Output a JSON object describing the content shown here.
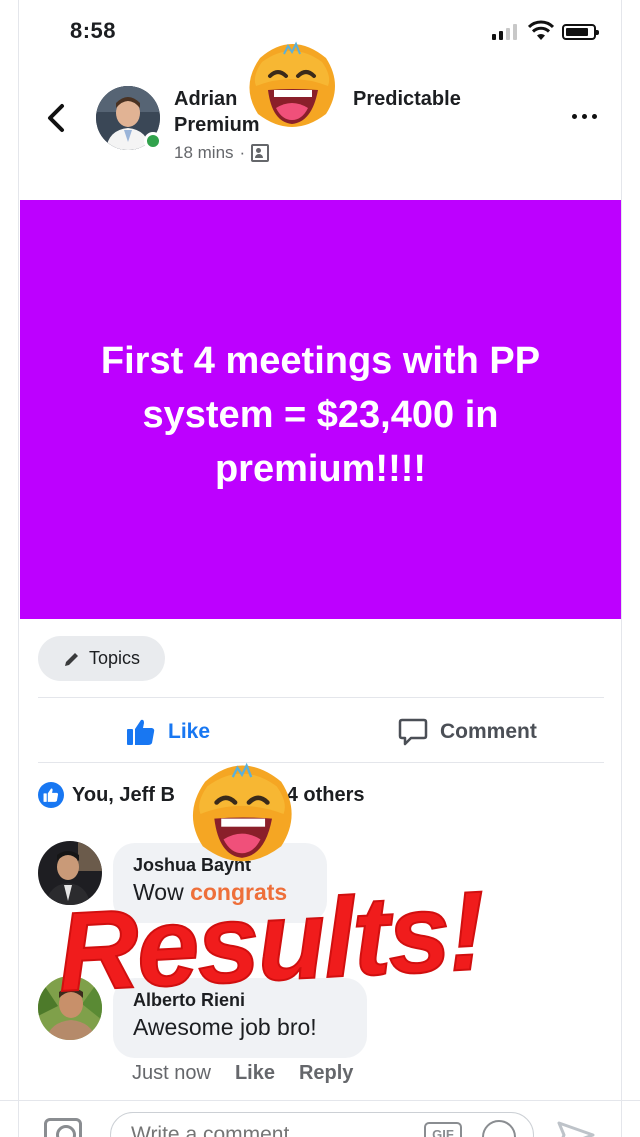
{
  "status_bar": {
    "time": "8:58"
  },
  "post": {
    "author_first": "Adrian",
    "group_name": "Predictable",
    "group_name_line2": "Premium",
    "time_ago": "18 mins",
    "separator": "·",
    "banner_text": "First 4 meetings with PP system = $23,400 in premium!!!!",
    "banner_color": "#bd00ff"
  },
  "topics": {
    "label": "Topics"
  },
  "actions": {
    "like": "Like",
    "comment": "Comment",
    "like_color": "#1877f2"
  },
  "reactions": {
    "summary_start": "You, Jeff B",
    "summary_end": "d 4 others"
  },
  "comments": [
    {
      "author": "Joshua Baynt",
      "text_plain": "Wow ",
      "text_highlight": "congrats",
      "highlight_color": "#ee6f3a"
    },
    {
      "author": "Alberto Rieni",
      "text": "Awesome job  bro!",
      "time": "Just now",
      "like": "Like",
      "reply": "Reply"
    }
  ],
  "composer": {
    "placeholder": "Write a comment...",
    "gif": "GIF"
  },
  "overlay": {
    "text": "Results!",
    "color": "#f01c1c"
  },
  "icons": {
    "back": "chevron-left-icon",
    "more": "more-dots-icon",
    "audience": "group-audience-icon",
    "pencil": "pencil-icon",
    "like": "thumbs-up-icon",
    "comment": "comment-bubble-icon",
    "camera": "camera-icon",
    "emoji": "emoji-icon",
    "send": "send-icon",
    "sticker": "laughing-emoji-sticker"
  }
}
